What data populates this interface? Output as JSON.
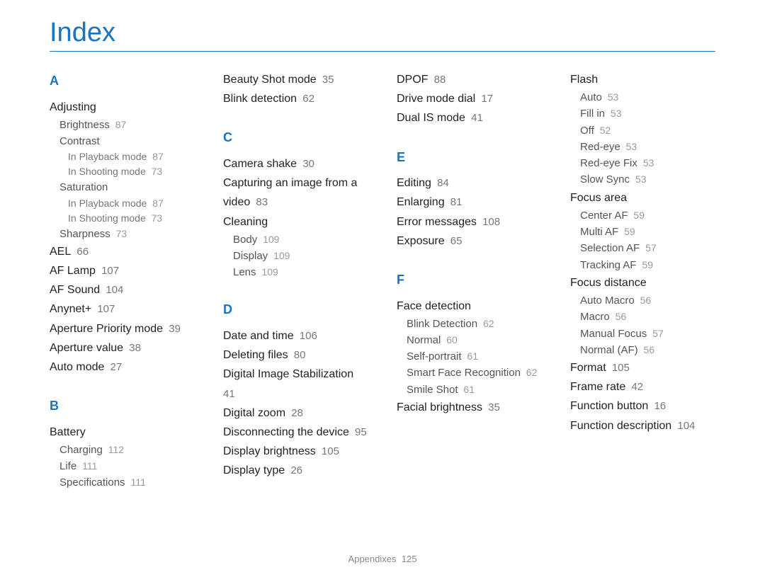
{
  "title": "Index",
  "footer": {
    "label": "Appendixes",
    "page": "125"
  },
  "columns": [
    [
      {
        "type": "letter",
        "text": "A",
        "first": true
      },
      {
        "type": "entry",
        "text": "Adjusting"
      },
      {
        "type": "sub",
        "text": "Brightness",
        "page": "87"
      },
      {
        "type": "sub",
        "text": "Contrast"
      },
      {
        "type": "subsub",
        "text": "In Playback mode",
        "page": "87"
      },
      {
        "type": "subsub",
        "text": "In Shooting mode",
        "page": "73"
      },
      {
        "type": "sub",
        "text": "Saturation"
      },
      {
        "type": "subsub",
        "text": "In Playback mode",
        "page": "87"
      },
      {
        "type": "subsub",
        "text": "In Shooting mode",
        "page": "73"
      },
      {
        "type": "sub",
        "text": "Sharpness",
        "page": "73"
      },
      {
        "type": "entry",
        "text": "AEL",
        "page": "66"
      },
      {
        "type": "entry",
        "text": "AF Lamp",
        "page": "107"
      },
      {
        "type": "entry",
        "text": "AF Sound",
        "page": "104"
      },
      {
        "type": "entry",
        "text": "Anynet+",
        "page": "107"
      },
      {
        "type": "entry",
        "text": "Aperture Priority mode",
        "page": "39"
      },
      {
        "type": "entry",
        "text": "Aperture value",
        "page": "38"
      },
      {
        "type": "entry",
        "text": "Auto mode",
        "page": "27"
      },
      {
        "type": "letter",
        "text": "B"
      },
      {
        "type": "entry",
        "text": "Battery"
      },
      {
        "type": "sub",
        "text": "Charging",
        "page": "112"
      },
      {
        "type": "sub",
        "text": "Life",
        "page": "111"
      },
      {
        "type": "sub",
        "text": "Specifications",
        "page": "111"
      }
    ],
    [
      {
        "type": "entry",
        "text": "Beauty Shot mode",
        "page": "35"
      },
      {
        "type": "entry",
        "text": "Blink detection",
        "page": "62"
      },
      {
        "type": "letter",
        "text": "C"
      },
      {
        "type": "entry",
        "text": "Camera shake",
        "page": "30"
      },
      {
        "type": "entry",
        "text": "Capturing an image from a video",
        "page": "83"
      },
      {
        "type": "entry",
        "text": "Cleaning"
      },
      {
        "type": "sub",
        "text": "Body",
        "page": "109"
      },
      {
        "type": "sub",
        "text": "Display",
        "page": "109"
      },
      {
        "type": "sub",
        "text": "Lens",
        "page": "109"
      },
      {
        "type": "letter",
        "text": "D"
      },
      {
        "type": "entry",
        "text": "Date and time",
        "page": "106"
      },
      {
        "type": "entry",
        "text": "Deleting files",
        "page": "80"
      },
      {
        "type": "entry",
        "text": "Digital Image Stabilization",
        "page": "41"
      },
      {
        "type": "entry",
        "text": "Digital zoom",
        "page": "28"
      },
      {
        "type": "entry",
        "text": "Disconnecting the device",
        "page": "95"
      },
      {
        "type": "entry",
        "text": "Display brightness",
        "page": "105"
      },
      {
        "type": "entry",
        "text": "Display type",
        "page": "26"
      }
    ],
    [
      {
        "type": "entry",
        "text": "DPOF",
        "page": "88"
      },
      {
        "type": "entry",
        "text": "Drive mode dial",
        "page": "17"
      },
      {
        "type": "entry",
        "text": "Dual IS mode",
        "page": "41"
      },
      {
        "type": "letter",
        "text": "E"
      },
      {
        "type": "entry",
        "text": "Editing",
        "page": "84"
      },
      {
        "type": "entry",
        "text": "Enlarging",
        "page": "81"
      },
      {
        "type": "entry",
        "text": "Error messages",
        "page": "108"
      },
      {
        "type": "entry",
        "text": "Exposure",
        "page": "65"
      },
      {
        "type": "letter",
        "text": "F"
      },
      {
        "type": "entry",
        "text": "Face detection"
      },
      {
        "type": "sub",
        "text": "Blink Detection",
        "page": "62"
      },
      {
        "type": "sub",
        "text": "Normal",
        "page": "60"
      },
      {
        "type": "sub",
        "text": "Self-portrait",
        "page": "61"
      },
      {
        "type": "sub",
        "text": "Smart Face Recognition",
        "page": "62"
      },
      {
        "type": "sub",
        "text": "Smile Shot",
        "page": "61"
      },
      {
        "type": "entry",
        "text": "Facial brightness",
        "page": "35"
      }
    ],
    [
      {
        "type": "entry",
        "text": "Flash"
      },
      {
        "type": "sub",
        "text": "Auto",
        "page": "53"
      },
      {
        "type": "sub",
        "text": "Fill in",
        "page": "53"
      },
      {
        "type": "sub",
        "text": "Off",
        "page": "52"
      },
      {
        "type": "sub",
        "text": "Red-eye",
        "page": "53"
      },
      {
        "type": "sub",
        "text": "Red-eye Fix",
        "page": "53"
      },
      {
        "type": "sub",
        "text": "Slow Sync",
        "page": "53"
      },
      {
        "type": "entry",
        "text": "Focus area"
      },
      {
        "type": "sub",
        "text": "Center AF",
        "page": "59"
      },
      {
        "type": "sub",
        "text": "Multi AF",
        "page": "59"
      },
      {
        "type": "sub",
        "text": "Selection AF",
        "page": "57"
      },
      {
        "type": "sub",
        "text": "Tracking AF",
        "page": "59"
      },
      {
        "type": "entry",
        "text": "Focus distance"
      },
      {
        "type": "sub",
        "text": "Auto Macro",
        "page": "56"
      },
      {
        "type": "sub",
        "text": "Macro",
        "page": "56"
      },
      {
        "type": "sub",
        "text": "Manual Focus",
        "page": "57"
      },
      {
        "type": "sub",
        "text": "Normal (AF)",
        "page": "56"
      },
      {
        "type": "entry",
        "text": "Format",
        "page": "105"
      },
      {
        "type": "entry",
        "text": "Frame rate",
        "page": "42"
      },
      {
        "type": "entry",
        "text": "Function button",
        "page": "16"
      },
      {
        "type": "entry",
        "text": "Function description",
        "page": "104"
      }
    ]
  ]
}
